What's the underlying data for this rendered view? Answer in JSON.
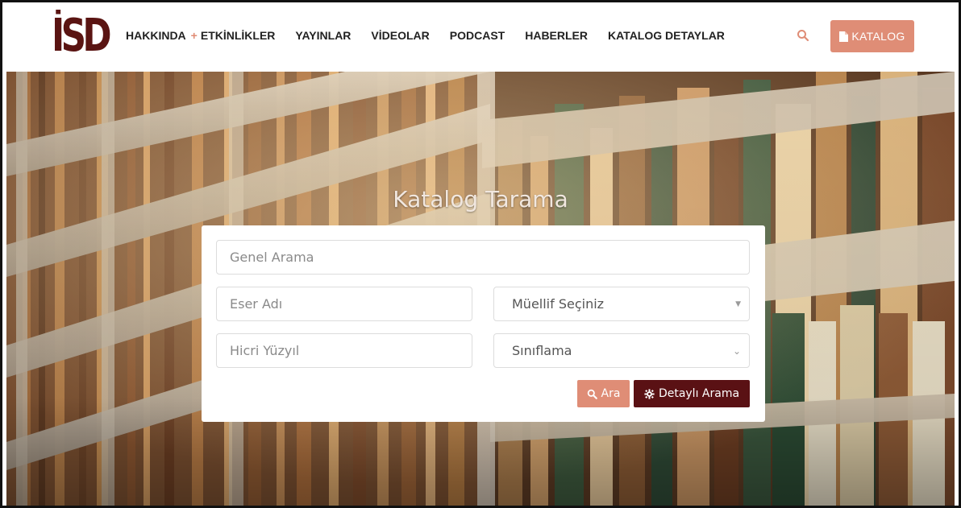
{
  "header": {
    "logo_text": "İSD",
    "nav": [
      {
        "label": "HAKKINDA"
      },
      {
        "label": "ETKİNLİKLER"
      },
      {
        "label": "YAYINLAR"
      },
      {
        "label": "VİDEOLAR"
      },
      {
        "label": "PODCAST"
      },
      {
        "label": "HABERLER"
      },
      {
        "label": "KATALOG DETAYLAR"
      }
    ],
    "plus": "+",
    "katalog_button": "KATALOG"
  },
  "hero": {
    "title": "Katalog Tarama"
  },
  "search": {
    "genel_placeholder": "Genel Arama",
    "eser_placeholder": "Eser Adı",
    "muellif_selected": "Müellif Seçiniz",
    "hicri_placeholder": "Hicri Yüzyıl",
    "siniflama_selected": "Sınıflama",
    "ara_button": "Ara",
    "detayli_button": "Detaylı Arama"
  },
  "colors": {
    "brand": "#5a1412",
    "accent": "#df8d76"
  },
  "icons": {
    "search": "search-icon",
    "document": "document-icon",
    "gear": "gear-icon"
  }
}
